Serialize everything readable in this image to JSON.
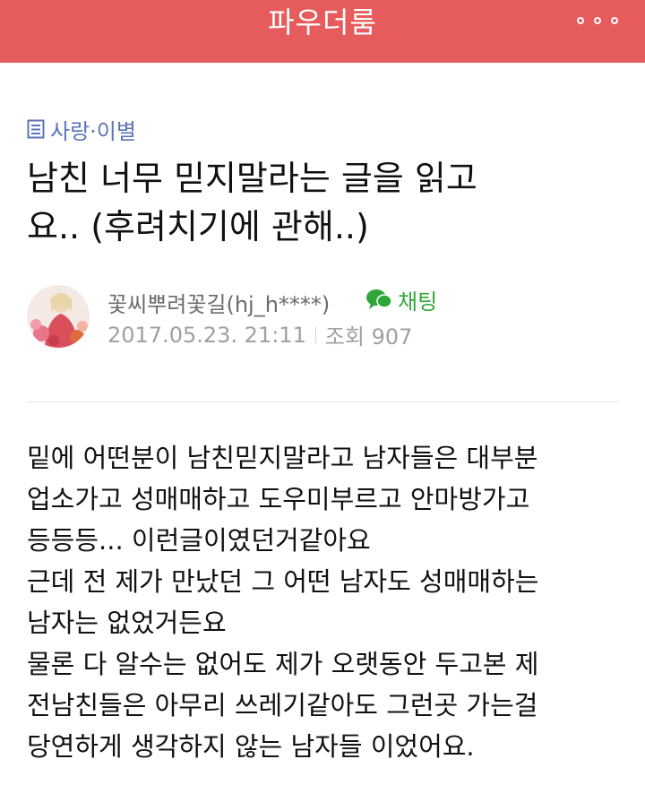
{
  "app": {
    "title": "파우더룸"
  },
  "post": {
    "category": "사랑·이별",
    "title_lines": [
      "남친 너무 믿지말라는 글을 읽고",
      "요.. (후려치기에 관해..)"
    ],
    "author": "꽃씨뿌려꽃길(hj_h****)",
    "chat_label": "채팅",
    "date": "2017.05.23. 21:11",
    "views_label": "조회 907",
    "body_lines": [
      "밑에 어떤분이 남친믿지말라고 남자들은 대부분",
      "업소가고 성매매하고 도우미부르고 안마방가고",
      "등등등... 이런글이였던거같아요",
      "근데 전 제가 만났던 그 어떤 남자도 성매매하는",
      "남자는 없었거든요",
      "물론 다 알수는 없어도 제가 오랫동안 두고본 제",
      "전남친들은 아무리 쓰레기같아도 그런곳 가는걸",
      "당연하게 생각하지 않는 남자들 이었어요."
    ]
  },
  "icons": {
    "more": "more-icon",
    "category": "document-icon",
    "chat": "chat-bubble-icon",
    "avatar": "avatar-photo"
  },
  "colors": {
    "topbar": "#e65b5b",
    "category": "#5b74b8",
    "chat": "#2fa63a",
    "meta": "#a0a0a0",
    "text": "#111111"
  }
}
